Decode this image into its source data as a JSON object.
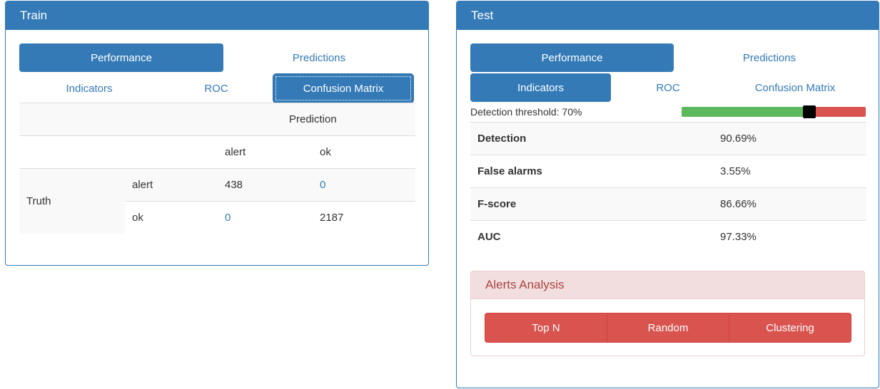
{
  "train": {
    "title": "Train",
    "tabs_top": [
      "Performance",
      "Predictions"
    ],
    "tabs_sub": [
      "Indicators",
      "ROC",
      "Confusion Matrix"
    ],
    "matrix": {
      "prediction_label": "Prediction",
      "col_headers": [
        "alert",
        "ok"
      ],
      "truth_label": "Truth",
      "rows": [
        {
          "label": "alert",
          "values": [
            "438",
            "0"
          ]
        },
        {
          "label": "ok",
          "values": [
            "0",
            "2187"
          ]
        }
      ]
    }
  },
  "test": {
    "title": "Test",
    "tabs_top": [
      "Performance",
      "Predictions"
    ],
    "tabs_sub": [
      "Indicators",
      "ROC",
      "Confusion Matrix"
    ],
    "threshold_label": "Detection threshold: 70%",
    "threshold_value": 0.7,
    "indicators": [
      {
        "name": "Detection",
        "value": "90.69%"
      },
      {
        "name": "False alarms",
        "value": "3.55%"
      },
      {
        "name": "F-score",
        "value": "86.66%"
      },
      {
        "name": "AUC",
        "value": "97.33%"
      }
    ],
    "alerts": {
      "title": "Alerts Analysis",
      "buttons": [
        "Top N",
        "Random",
        "Clustering"
      ]
    }
  },
  "colors": {
    "primary": "#337ab7",
    "danger": "#d9534f",
    "slider_low": "#5cb85c",
    "slider_high": "#d9534f"
  }
}
